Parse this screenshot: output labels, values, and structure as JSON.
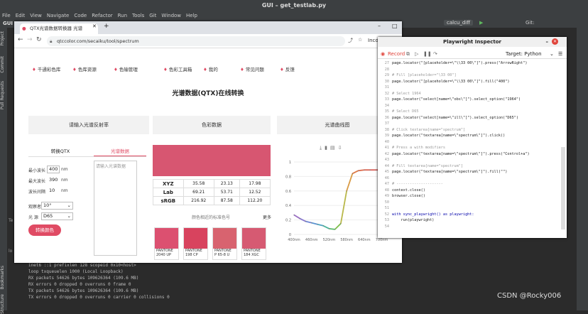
{
  "ide": {
    "title": "GUI – get_testlab.py",
    "menu": [
      "File",
      "Edit",
      "View",
      "Navigate",
      "Code",
      "Refactor",
      "Run",
      "Tools",
      "Git",
      "Window",
      "Help"
    ],
    "project_label": "GUI",
    "run_config": "calcu_diff",
    "git_label": "Git:",
    "side_tabs": [
      "Project",
      "Commit",
      "Pull Requests"
    ],
    "bottom_side_tabs": [
      "Bookmarks",
      "Structure"
    ],
    "term_tab": "Te",
    "terminal_lines": [
      "inet6 ::1  prefixlen 128  scopeid 0x10<host>",
      "loop  txqueuelen 1000  (Local Loopback)",
      "RX packets 54626  bytes 109626364 (109.6 MB)",
      "RX errors 0  dropped 0  overruns 0  frame 0",
      "TX packets 54626  bytes 109626364 (109.6 MB)",
      "TX errors 0  dropped 0 overruns 0  carrier 0  collisions 0"
    ],
    "term_left": [
      "lo"
    ]
  },
  "browser": {
    "tab_title": "QTX光谱数据转换器 光谱",
    "url": "qtccolor.com/secaiku/tool/spectrum",
    "profile": "Incog"
  },
  "site": {
    "nav": [
      "千通彩色库",
      "色库资源",
      "色输管理",
      "色彩工具箱",
      "我的",
      "常见问题",
      "反馈"
    ],
    "page_title": "光谱数据(QTX)在线转换",
    "headers": [
      "请输入光谱反射率",
      "色彩数据",
      "光谱曲线图"
    ],
    "tab_qtx": "转换QTX",
    "tab_spectrum": "光谱数据",
    "textarea_placeholder": "请输入光谱数据",
    "form": {
      "min_label": "最小波长",
      "min_value": "400",
      "max_label": "最大波长",
      "max_value": "390",
      "step_label": "波长间隔",
      "step_value": "10",
      "unit": "nm",
      "observer_label": "观察者",
      "observer_value": "10°",
      "light_label": "光 源",
      "light_value": "D65",
      "convert_button": "转换颜色"
    },
    "color_rows": [
      {
        "name": "XYZ",
        "v": [
          "35.58",
          "23.13",
          "17.98"
        ]
      },
      {
        "name": "Lab",
        "v": [
          "69.21",
          "53.71",
          "12.52"
        ]
      },
      {
        "name": "sRGB",
        "v": [
          "216.92",
          "87.58",
          "112.20"
        ]
      }
    ],
    "pantone_title": "颜色相近的标准色号",
    "more": "更多",
    "main_color": "#d75671",
    "pantones": [
      {
        "color": "#dc5070",
        "line1": "PANTONE",
        "line2": "2040 UP"
      },
      {
        "color": "#d8435e",
        "line1": "PANTONE",
        "line2": "198 CP"
      },
      {
        "color": "#d8636f",
        "line1": "PANTONE",
        "line2": "P 65-8 U"
      },
      {
        "color": "#d65a72",
        "line1": "PANTONE",
        "line2": "184 XGC"
      }
    ],
    "chart_data": {
      "type": "line",
      "x": [
        400,
        420,
        440,
        460,
        480,
        500,
        520,
        540,
        560,
        580,
        600,
        620,
        640,
        660,
        680,
        700,
        720,
        740
      ],
      "y": [
        0.27,
        0.22,
        0.18,
        0.16,
        0.14,
        0.12,
        0.08,
        0.07,
        0.15,
        0.6,
        0.84,
        0.88,
        0.89,
        0.89,
        0.89,
        0.89,
        0.89,
        0.89
      ],
      "xticks": [
        "400nm",
        "460nm",
        "520nm",
        "580nm",
        "640nm",
        "700nm"
      ],
      "yticks": [
        "1",
        "0.8",
        "0.6",
        "0.4",
        "0.2",
        "0"
      ],
      "ylim": [
        0,
        1
      ]
    }
  },
  "inspector": {
    "title": "Playwright Inspector",
    "record": "Record",
    "target": "Target: Python",
    "lines": [
      {
        "n": "27",
        "t": "page.locator(\"[placeholder=\\\"\\\\33 00\\\"]\").press(\"ArrowRight\")",
        "c": "code"
      },
      {
        "n": "28",
        "t": "",
        "c": "code"
      },
      {
        "n": "29",
        "t": "# Fill [placeholder=\"\\33 00\"]",
        "c": "cm"
      },
      {
        "n": "30",
        "t": "page.locator(\"[placeholder=\\\"\\\\33 00\\\"]\").fill(\"400\")",
        "c": "code"
      },
      {
        "n": "31",
        "t": "",
        "c": "code"
      },
      {
        "n": "32",
        "t": "# Select 1964",
        "c": "cm"
      },
      {
        "n": "33",
        "t": "page.locator(\"select[name=\\\"obs\\\"]\").select_option(\"1964\")",
        "c": "code"
      },
      {
        "n": "34",
        "t": "",
        "c": "code"
      },
      {
        "n": "35",
        "t": "# Select D65",
        "c": "cm"
      },
      {
        "n": "36",
        "t": "page.locator(\"select[name=\\\"ill\\\"]\").select_option(\"D65\")",
        "c": "code"
      },
      {
        "n": "37",
        "t": "",
        "c": "code"
      },
      {
        "n": "38",
        "t": "# Click textarea[name=\"spectrum\"]",
        "c": "cm"
      },
      {
        "n": "39",
        "t": "page.locator(\"textarea[name=\\\"spectrum\\\"]\").click()",
        "c": "code"
      },
      {
        "n": "40",
        "t": "",
        "c": "code"
      },
      {
        "n": "41",
        "t": "# Press a with modifiers",
        "c": "cm"
      },
      {
        "n": "42",
        "t": "page.locator(\"textarea[name=\\\"spectrum\\\"]\").press(\"Control+a\")",
        "c": "code"
      },
      {
        "n": "43",
        "t": "",
        "c": "code"
      },
      {
        "n": "44",
        "t": "# Fill textarea[name=\"spectrum\"]",
        "c": "cm"
      },
      {
        "n": "45",
        "t": "page.locator(\"textarea[name=\\\"spectrum\\\"]\").fill(\"\")",
        "c": "code"
      },
      {
        "n": "46",
        "t": "",
        "c": "code"
      },
      {
        "n": "47",
        "t": "# ---------------------",
        "c": "cm"
      },
      {
        "n": "48",
        "t": "context.close()",
        "c": "code"
      },
      {
        "n": "49",
        "t": "browser.close()",
        "c": "code"
      },
      {
        "n": "50",
        "t": "",
        "c": "code"
      },
      {
        "n": "51",
        "t": "",
        "c": "code"
      },
      {
        "n": "52",
        "t": "with sync_playwright() as playwright:",
        "c": "kw"
      },
      {
        "n": "53",
        "t": "    run(playwright)",
        "c": "code"
      },
      {
        "n": "54",
        "t": "",
        "c": "code"
      }
    ]
  },
  "watermark": "CSDN @Rocky006"
}
